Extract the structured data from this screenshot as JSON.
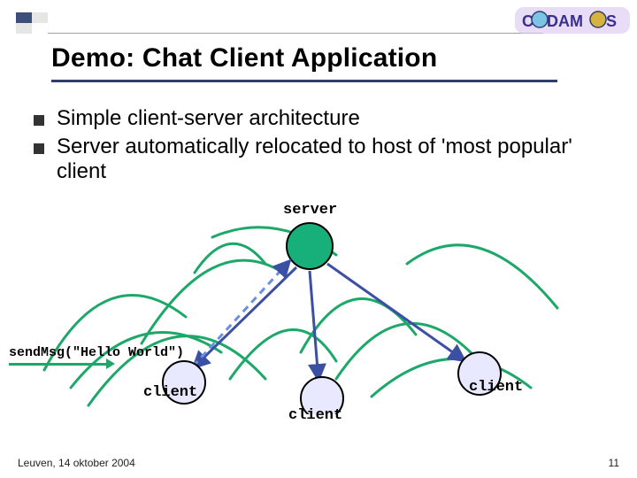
{
  "brand": {
    "name": "CoDAMoS"
  },
  "title": "Demo: Chat Client Application",
  "bullets": [
    "Simple client-server architecture",
    "Server automatically relocated to host of 'most popular' client"
  ],
  "diagram": {
    "server_label": "server",
    "client_labels": [
      "client",
      "client",
      "client"
    ],
    "call_label": "sendMsg(\"Hello World\")",
    "colors": {
      "accent_green": "#1da86a",
      "server_fill": "#18b07a",
      "client_fill": "#e8e8ff",
      "arrow_blue": "#3b4fa3",
      "dash_blue": "#6a8fe6"
    }
  },
  "footer": {
    "left": "Leuven, 14 oktober 2004",
    "page": "11"
  }
}
